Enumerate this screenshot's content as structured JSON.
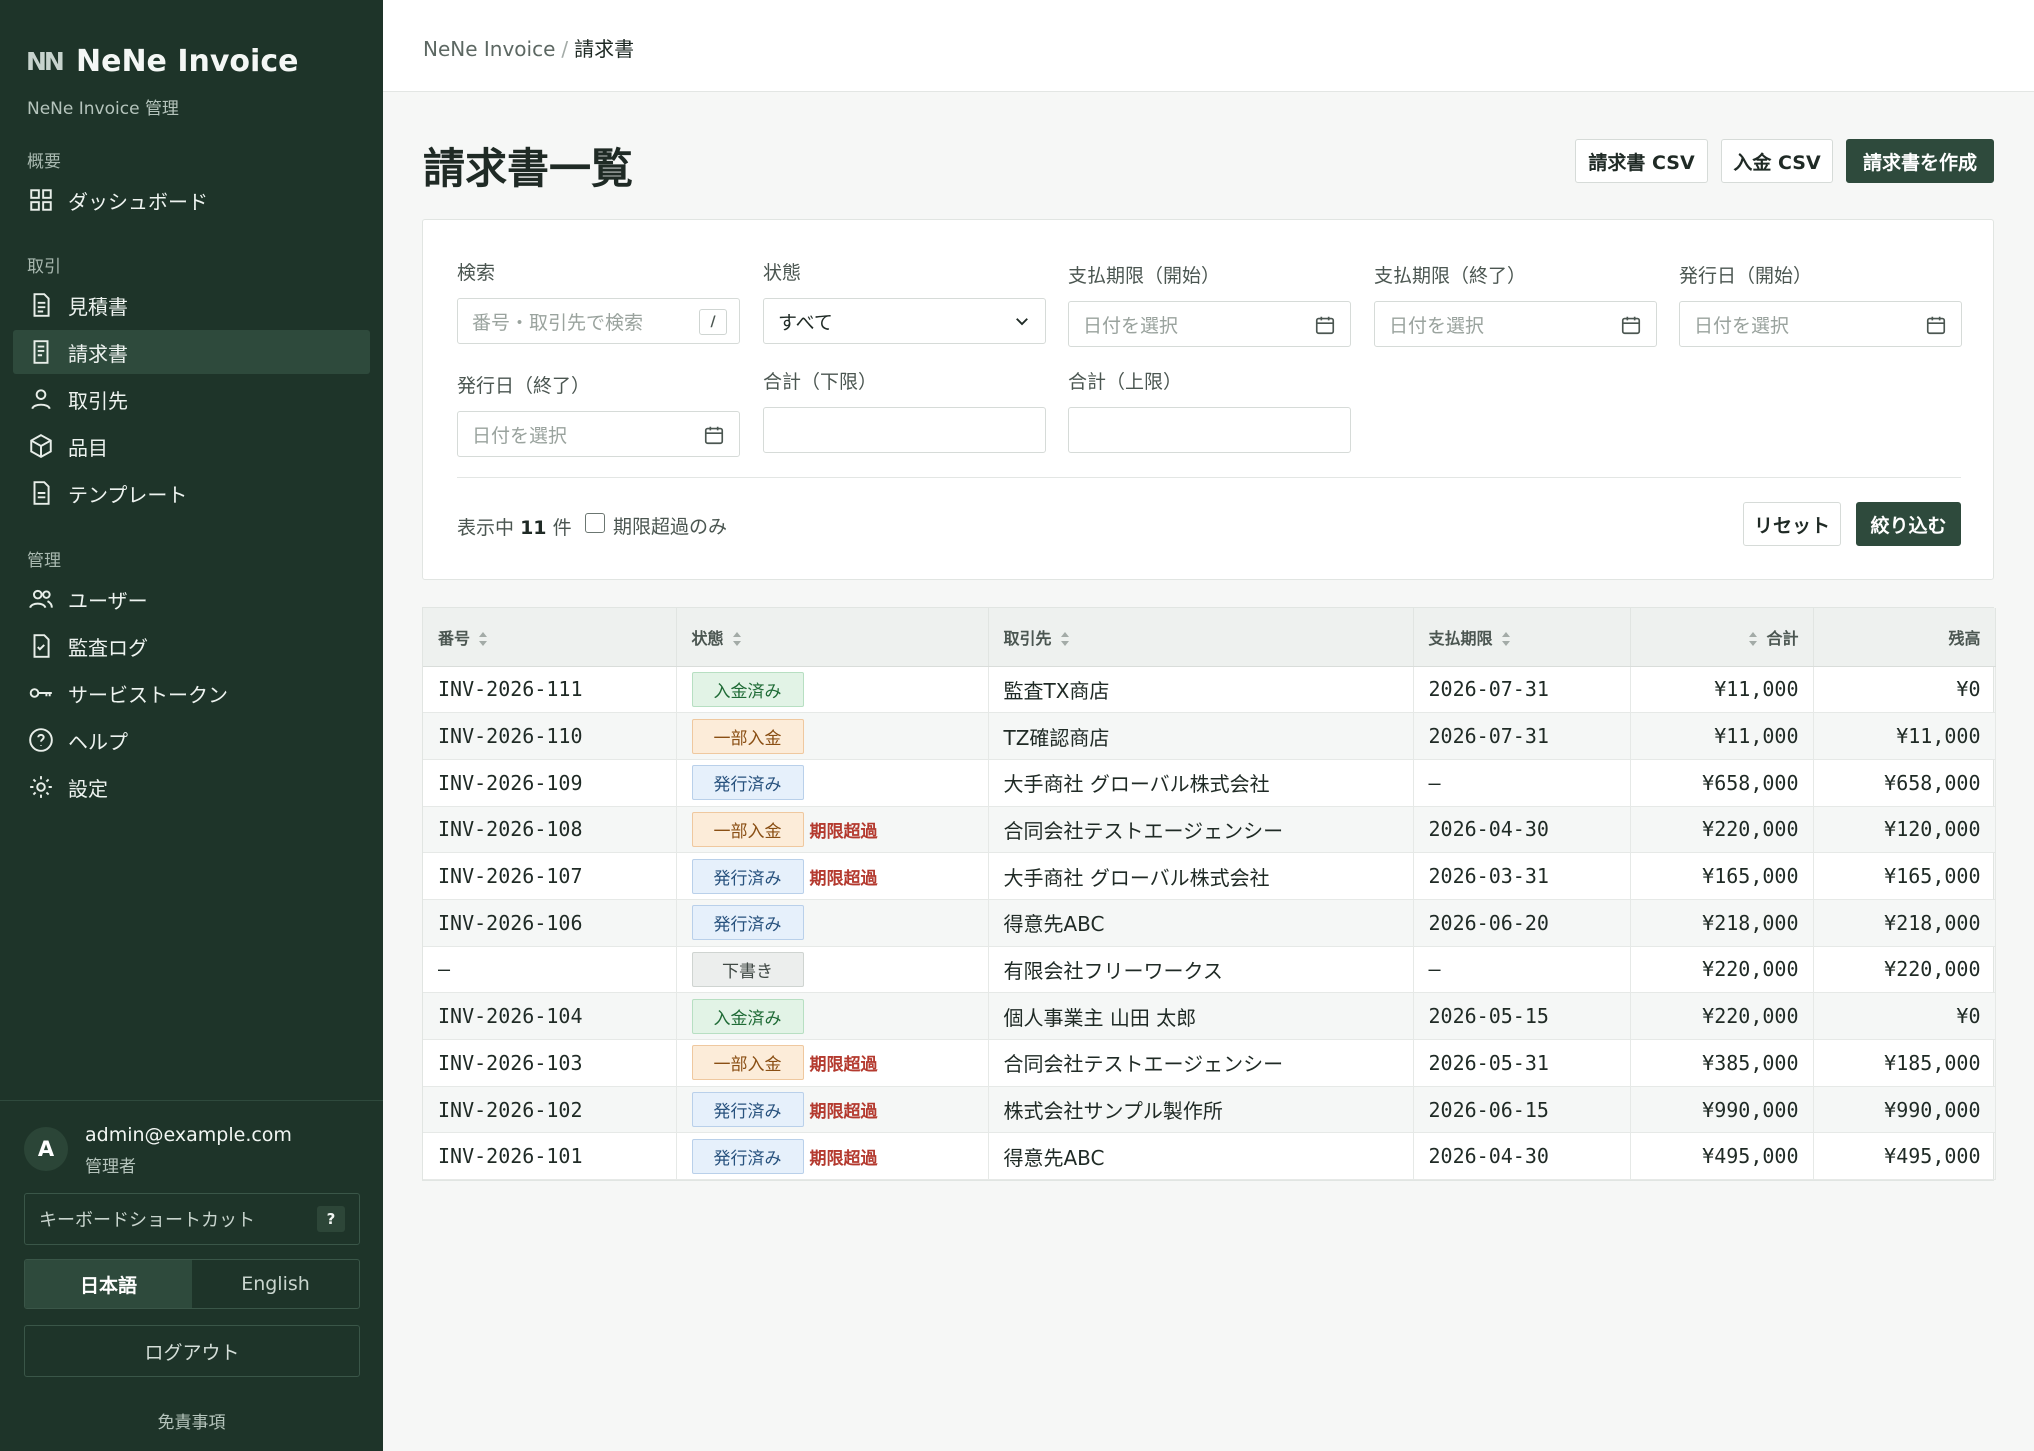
{
  "sidebar": {
    "brand_logo": "NN",
    "brand_name": "NeNe Invoice",
    "brand_sub": "NeNe Invoice 管理",
    "sections": {
      "overview": "概要",
      "transactions": "取引",
      "admin": "管理"
    },
    "items": {
      "dashboard": "ダッシュボード",
      "estimates": "見積書",
      "invoices": "請求書",
      "clients": "取引先",
      "products": "品目",
      "templates": "テンプレート",
      "users": "ユーザー",
      "audit_log": "監査ログ",
      "service_tokens": "サービストークン",
      "help": "ヘルプ",
      "settings": "設定"
    },
    "user": {
      "avatar": "A",
      "email": "admin@example.com",
      "role": "管理者"
    },
    "keyboard_shortcuts": "キーボードショートカット",
    "keyboard_key": "?",
    "lang_ja": "日本語",
    "lang_en": "English",
    "logout": "ログアウト",
    "disclaimer": "免責事項"
  },
  "header": {
    "breadcrumb_root": "NeNe Invoice",
    "breadcrumb_sep": "/",
    "breadcrumb_current": "請求書"
  },
  "page": {
    "title": "請求書一覧",
    "btn_invoice_csv": "請求書 CSV",
    "btn_payment_csv": "入金 CSV",
    "btn_create": "請求書を作成"
  },
  "filters": {
    "search_label": "検索",
    "search_placeholder": "番号・取引先で検索",
    "search_key": "/",
    "status_label": "状態",
    "status_value": "すべて",
    "due_start_label": "支払期限（開始）",
    "due_end_label": "支払期限（終了）",
    "issue_start_label": "発行日（開始）",
    "issue_end_label": "発行日（終了）",
    "total_min_label": "合計（下限）",
    "total_max_label": "合計（上限）",
    "date_placeholder": "日付を選択",
    "count_prefix": "表示中",
    "count_value": "11",
    "count_suffix": "件",
    "overdue_only": "期限超過のみ",
    "reset": "リセット",
    "apply": "絞り込む"
  },
  "table": {
    "headers": {
      "number": "番号",
      "status": "状態",
      "client": "取引先",
      "due": "支払期限",
      "total": "合計",
      "balance": "残高"
    },
    "overdue_label": "期限超過",
    "rows": [
      {
        "number": "INV-2026-111",
        "status": "入金済み",
        "status_kind": "paid",
        "overdue": false,
        "client": "監査TX商店",
        "due": "2026-07-31",
        "total": "¥11,000",
        "balance": "¥0"
      },
      {
        "number": "INV-2026-110",
        "status": "一部入金",
        "status_kind": "partial",
        "overdue": false,
        "client": "TZ確認商店",
        "due": "2026-07-31",
        "total": "¥11,000",
        "balance": "¥11,000"
      },
      {
        "number": "INV-2026-109",
        "status": "発行済み",
        "status_kind": "issued",
        "overdue": false,
        "client": "大手商社 グローバル株式会社",
        "due": "–",
        "total": "¥658,000",
        "balance": "¥658,000"
      },
      {
        "number": "INV-2026-108",
        "status": "一部入金",
        "status_kind": "partial",
        "overdue": true,
        "client": "合同会社テストエージェンシー",
        "due": "2026-04-30",
        "total": "¥220,000",
        "balance": "¥120,000"
      },
      {
        "number": "INV-2026-107",
        "status": "発行済み",
        "status_kind": "issued",
        "overdue": true,
        "client": "大手商社 グローバル株式会社",
        "due": "2026-03-31",
        "total": "¥165,000",
        "balance": "¥165,000"
      },
      {
        "number": "INV-2026-106",
        "status": "発行済み",
        "status_kind": "issued",
        "overdue": false,
        "client": "得意先ABC",
        "due": "2026-06-20",
        "total": "¥218,000",
        "balance": "¥218,000"
      },
      {
        "number": "–",
        "status": "下書き",
        "status_kind": "draft",
        "overdue": false,
        "client": "有限会社フリーワークス",
        "due": "–",
        "total": "¥220,000",
        "balance": "¥220,000"
      },
      {
        "number": "INV-2026-104",
        "status": "入金済み",
        "status_kind": "paid",
        "overdue": false,
        "client": "個人事業主 山田 太郎",
        "due": "2026-05-15",
        "total": "¥220,000",
        "balance": "¥0"
      },
      {
        "number": "INV-2026-103",
        "status": "一部入金",
        "status_kind": "partial",
        "overdue": true,
        "client": "合同会社テストエージェンシー",
        "due": "2026-05-31",
        "total": "¥385,000",
        "balance": "¥185,000"
      },
      {
        "number": "INV-2026-102",
        "status": "発行済み",
        "status_kind": "issued",
        "overdue": true,
        "client": "株式会社サンプル製作所",
        "due": "2026-06-15",
        "total": "¥990,000",
        "balance": "¥990,000"
      },
      {
        "number": "INV-2026-101",
        "status": "発行済み",
        "status_kind": "issued",
        "overdue": true,
        "client": "得意先ABC",
        "due": "2026-04-30",
        "total": "¥495,000",
        "balance": "¥495,000"
      }
    ]
  },
  "colors": {
    "sidebar_bg": "#1e3429",
    "accent": "#2e4a3c",
    "overdue": "#b43a2f"
  }
}
